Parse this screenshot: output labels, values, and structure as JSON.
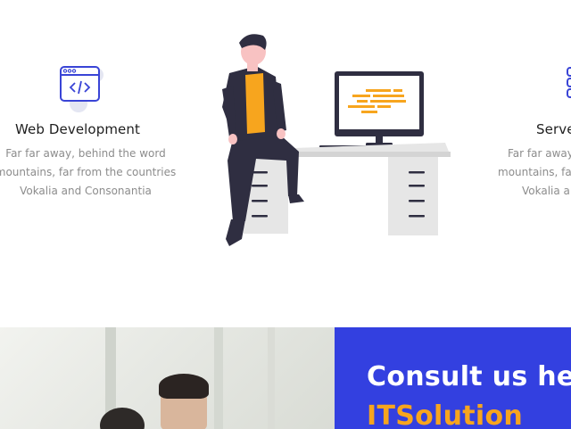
{
  "services": [
    {
      "title": "Web Development",
      "lines": [
        "Far far away, behind the word",
        "mountains, far from the countries",
        "Vokalia and Consonantia"
      ],
      "icon": "code-window-icon"
    },
    {
      "title": "Serve",
      "lines": [
        "Far far away",
        "mountains, fa",
        "Vokalia a"
      ],
      "icon": "server-icon"
    }
  ],
  "illustration": {
    "icon": "developer-at-desk-illustration"
  },
  "consult": {
    "title": "Consult us here",
    "brand": "ITSolution"
  },
  "colors": {
    "accent_blue": "#3340e0",
    "accent_orange": "#f7a51e",
    "icon_blue": "#3944d6"
  }
}
